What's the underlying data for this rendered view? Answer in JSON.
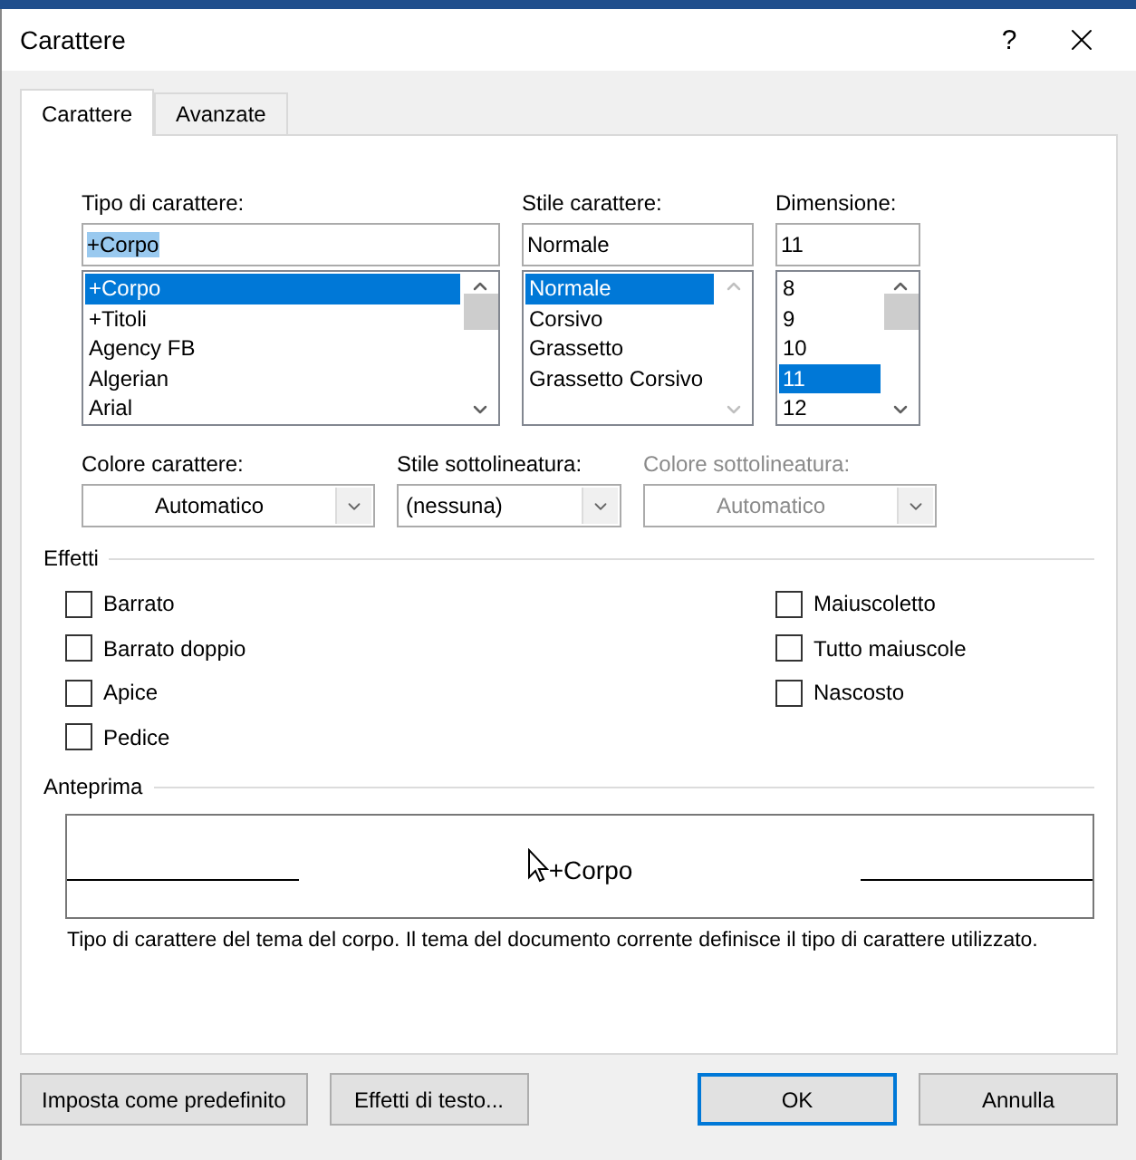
{
  "window": {
    "title": "Carattere",
    "help": "?"
  },
  "tabs": [
    {
      "label": "Carattere",
      "selected": true
    },
    {
      "label": "Avanzate",
      "selected": false
    }
  ],
  "font_fields": [
    {
      "label": "Tipo di carattere:",
      "value": "+Corpo",
      "value_highlighted": true,
      "scroll_disabled": false,
      "items": [
        {
          "label": "+Corpo",
          "selected": true
        },
        {
          "label": "+Titoli",
          "selected": false
        },
        {
          "label": "Agency FB",
          "selected": false
        },
        {
          "label": "Algerian",
          "selected": false
        },
        {
          "label": "Arial",
          "selected": false
        }
      ]
    },
    {
      "label": "Stile carattere:",
      "value": "Normale",
      "value_highlighted": false,
      "scroll_disabled": true,
      "items": [
        {
          "label": "Normale",
          "selected": true
        },
        {
          "label": "Corsivo",
          "selected": false
        },
        {
          "label": "Grassetto",
          "selected": false
        },
        {
          "label": "Grassetto Corsivo",
          "selected": false
        }
      ]
    },
    {
      "label": "Dimensione:",
      "value": "11",
      "value_highlighted": false,
      "scroll_disabled": false,
      "items": [
        {
          "label": "8",
          "selected": false
        },
        {
          "label": "9",
          "selected": false
        },
        {
          "label": "10",
          "selected": false
        },
        {
          "label": "11",
          "selected": true
        },
        {
          "label": "12",
          "selected": false
        }
      ]
    }
  ],
  "dropdowns": [
    {
      "label": "Colore carattere:",
      "value": "Automatico",
      "disabled": false,
      "kind": "color"
    },
    {
      "label": "Stile sottolineatura:",
      "value": "(nessuna)",
      "disabled": false,
      "kind": "style"
    },
    {
      "label": "Colore sottolineatura:",
      "value": "Automatico",
      "disabled": true,
      "kind": "color"
    }
  ],
  "effects": {
    "title": "Effetti",
    "left_options": [
      {
        "label": "Barrato",
        "checked": false
      },
      {
        "label": "Barrato doppio",
        "checked": false
      },
      {
        "label": "Apice",
        "checked": false
      },
      {
        "label": "Pedice",
        "checked": false
      }
    ],
    "right_options": [
      {
        "label": "Maiuscoletto",
        "checked": false
      },
      {
        "label": "Tutto maiuscole",
        "checked": false
      },
      {
        "label": "Nascosto",
        "checked": false
      }
    ]
  },
  "preview": {
    "title": "Anteprima",
    "sample": "+Corpo",
    "description": "Tipo di carattere del tema del corpo. Il tema del documento corrente definisce il tipo di carattere utilizzato."
  },
  "buttons_left": [
    {
      "label": "Imposta come predefinito",
      "default": false
    },
    {
      "label": "Effetti di testo...",
      "default": false
    }
  ],
  "buttons_right": [
    {
      "label": "OK",
      "default": true
    },
    {
      "label": "Annulla",
      "default": false
    }
  ]
}
